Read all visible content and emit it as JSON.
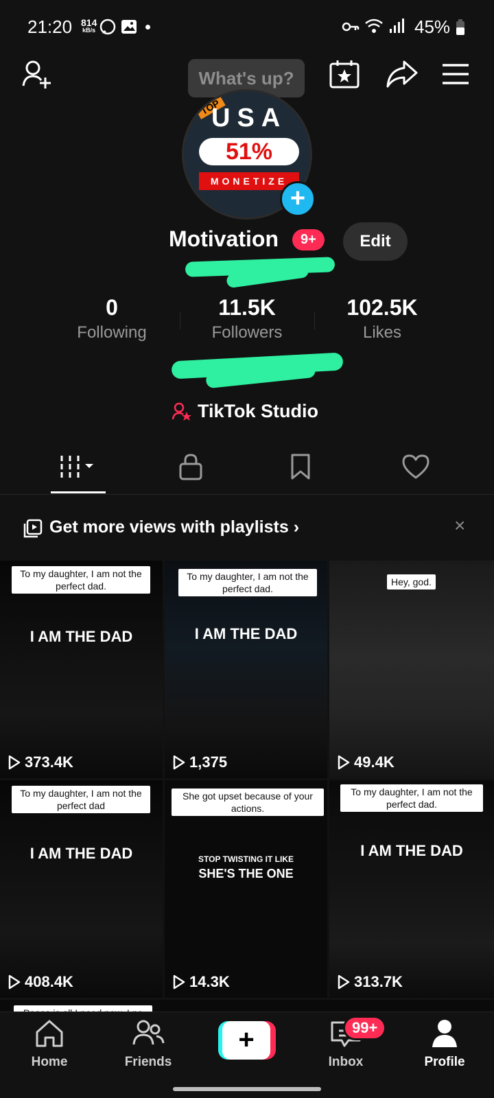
{
  "status_bar": {
    "time": "21:20",
    "speed_value": "814",
    "speed_unit": "kB/s",
    "battery": "45%"
  },
  "top_bar": {
    "tooltip": "What's up?"
  },
  "profile": {
    "avatar_top": "TOP",
    "avatar_text": "USA",
    "avatar_pct": "51%",
    "avatar_sub": "MONETIZE",
    "name": "Motivation",
    "badge": "9+",
    "edit_label": "Edit"
  },
  "stats": [
    {
      "value": "0",
      "label": "Following"
    },
    {
      "value": "11.5K",
      "label": "Followers"
    },
    {
      "value": "102.5K",
      "label": "Likes"
    }
  ],
  "studio_label": "TikTok Studio",
  "playlist_banner": {
    "text": "Get more views with playlists",
    "chevron": "›",
    "close": "×"
  },
  "videos": [
    {
      "caption": "To my daughter, I am not the perfect dad.",
      "title": "I AM THE DAD",
      "views": "373.4K"
    },
    {
      "caption": "To my daughter, I am not the perfect dad.",
      "title": "I AM THE DAD",
      "views": "1,375"
    },
    {
      "caption": "Hey, god.",
      "title": "",
      "views": "49.4K"
    },
    {
      "caption": "To my daughter, I am not the perfect dad",
      "title": "I AM THE DAD",
      "views": "408.4K"
    },
    {
      "caption": "She got upset because of your actions.",
      "title_small": "STOP TWISTING IT LIKE",
      "title": "SHE'S THE ONE",
      "views": "14.3K"
    },
    {
      "caption": "To my daughter, I am not the perfect dad.",
      "title": "I AM THE DAD",
      "views": "313.7K"
    }
  ],
  "peek_caption": "Peace is all I need now. I no",
  "nav": {
    "home": "Home",
    "friends": "Friends",
    "create": "+",
    "inbox": "Inbox",
    "inbox_badge": "99+",
    "profile": "Profile"
  }
}
